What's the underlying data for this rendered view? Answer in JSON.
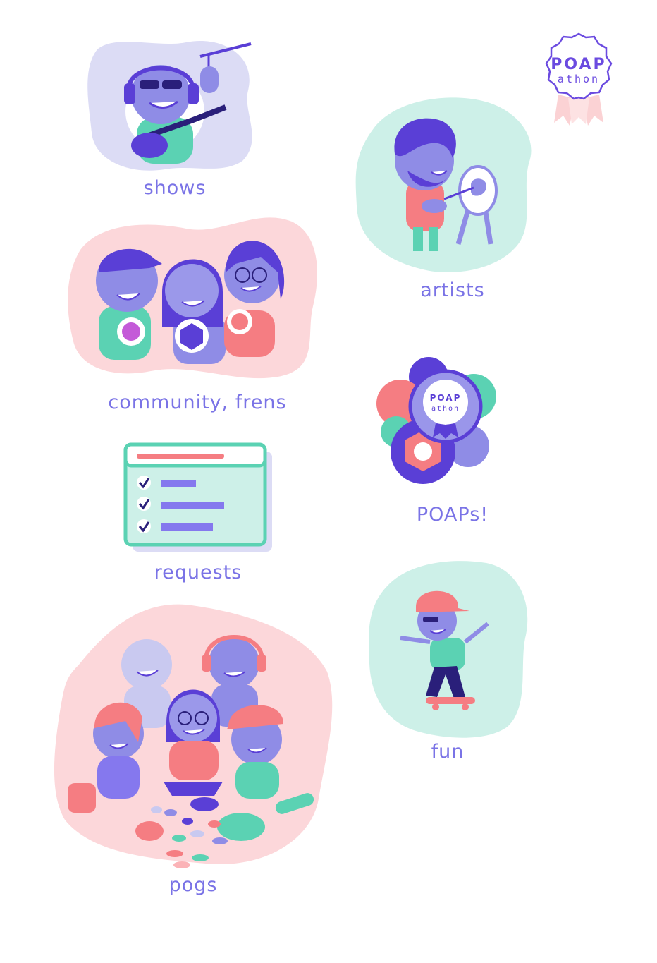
{
  "logo": {
    "line1": "POAP",
    "line2": "athon"
  },
  "captions": {
    "shows": "shows",
    "artists": "artists",
    "community": "community, frens",
    "poaps": "POAPs!",
    "requests": "requests",
    "fun": "fun",
    "pogs": "pogs"
  },
  "badge": {
    "line1": "POAP",
    "line2": "athon"
  },
  "colors": {
    "lavender": "#dcdcf5",
    "mint": "#cdf0e8",
    "pink": "#fcd7da",
    "purple": "#5a3fd6",
    "violet": "#8f8ce6",
    "teal": "#5bd2b3",
    "coral": "#f57d82",
    "text": "#7a73e6"
  },
  "icons": {
    "logo": "poap-athon-badge-icon",
    "check": "checkmark-icon"
  }
}
